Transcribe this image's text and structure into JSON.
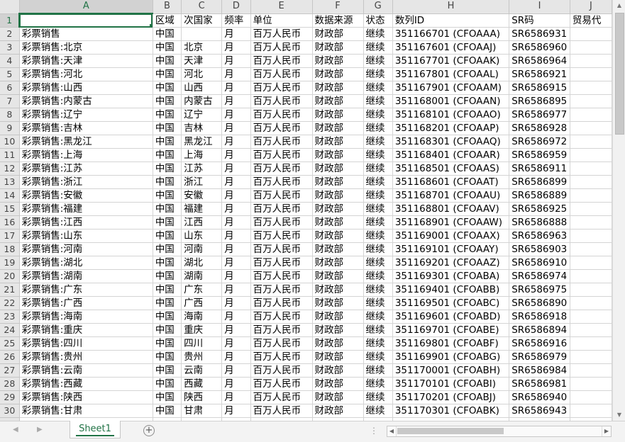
{
  "columns": [
    "A",
    "B",
    "C",
    "D",
    "E",
    "F",
    "G",
    "H",
    "I",
    "J"
  ],
  "header": [
    "",
    "区域",
    "次国家",
    "频率",
    "单位",
    "数据来源",
    "状态",
    "数列ID",
    "SR码",
    "贸易代"
  ],
  "rows": [
    [
      "彩票销售",
      "中国",
      "",
      "月",
      "百万人民币",
      "财政部",
      "继续",
      "351166701 (CFOAAA)",
      "SR6586931",
      ""
    ],
    [
      "彩票销售:北京",
      "中国",
      "北京",
      "月",
      "百万人民币",
      "财政部",
      "继续",
      "351167601 (CFOAAJ)",
      "SR6586960",
      ""
    ],
    [
      "彩票销售:天津",
      "中国",
      "天津",
      "月",
      "百万人民币",
      "财政部",
      "继续",
      "351167701 (CFOAAK)",
      "SR6586964",
      ""
    ],
    [
      "彩票销售:河北",
      "中国",
      "河北",
      "月",
      "百万人民币",
      "财政部",
      "继续",
      "351167801 (CFOAAL)",
      "SR6586921",
      ""
    ],
    [
      "彩票销售:山西",
      "中国",
      "山西",
      "月",
      "百万人民币",
      "财政部",
      "继续",
      "351167901 (CFOAAM)",
      "SR6586915",
      ""
    ],
    [
      "彩票销售:内蒙古",
      "中国",
      "内蒙古",
      "月",
      "百万人民币",
      "财政部",
      "继续",
      "351168001 (CFOAAN)",
      "SR6586895",
      ""
    ],
    [
      "彩票销售:辽宁",
      "中国",
      "辽宁",
      "月",
      "百万人民币",
      "财政部",
      "继续",
      "351168101 (CFOAAO)",
      "SR6586977",
      ""
    ],
    [
      "彩票销售:吉林",
      "中国",
      "吉林",
      "月",
      "百万人民币",
      "财政部",
      "继续",
      "351168201 (CFOAAP)",
      "SR6586928",
      ""
    ],
    [
      "彩票销售:黑龙江",
      "中国",
      "黑龙江",
      "月",
      "百万人民币",
      "财政部",
      "继续",
      "351168301 (CFOAAQ)",
      "SR6586972",
      ""
    ],
    [
      "彩票销售:上海",
      "中国",
      "上海",
      "月",
      "百万人民币",
      "财政部",
      "继续",
      "351168401 (CFOAAR)",
      "SR6586959",
      ""
    ],
    [
      "彩票销售:江苏",
      "中国",
      "江苏",
      "月",
      "百万人民币",
      "财政部",
      "继续",
      "351168501 (CFOAAS)",
      "SR6586911",
      ""
    ],
    [
      "彩票销售:浙江",
      "中国",
      "浙江",
      "月",
      "百万人民币",
      "财政部",
      "继续",
      "351168601 (CFOAAT)",
      "SR6586899",
      ""
    ],
    [
      "彩票销售:安徽",
      "中国",
      "安徽",
      "月",
      "百万人民币",
      "财政部",
      "继续",
      "351168701 (CFOAAU)",
      "SR6586889",
      ""
    ],
    [
      "彩票销售:福建",
      "中国",
      "福建",
      "月",
      "百万人民币",
      "财政部",
      "继续",
      "351168801 (CFOAAV)",
      "SR6586925",
      ""
    ],
    [
      "彩票销售:江西",
      "中国",
      "江西",
      "月",
      "百万人民币",
      "财政部",
      "继续",
      "351168901 (CFOAAW)",
      "SR6586888",
      ""
    ],
    [
      "彩票销售:山东",
      "中国",
      "山东",
      "月",
      "百万人民币",
      "财政部",
      "继续",
      "351169001 (CFOAAX)",
      "SR6586963",
      ""
    ],
    [
      "彩票销售:河南",
      "中国",
      "河南",
      "月",
      "百万人民币",
      "财政部",
      "继续",
      "351169101 (CFOAAY)",
      "SR6586903",
      ""
    ],
    [
      "彩票销售:湖北",
      "中国",
      "湖北",
      "月",
      "百万人民币",
      "财政部",
      "继续",
      "351169201 (CFOAAZ)",
      "SR6586910",
      ""
    ],
    [
      "彩票销售:湖南",
      "中国",
      "湖南",
      "月",
      "百万人民币",
      "财政部",
      "继续",
      "351169301 (CFOABA)",
      "SR6586974",
      ""
    ],
    [
      "彩票销售:广东",
      "中国",
      "广东",
      "月",
      "百万人民币",
      "财政部",
      "继续",
      "351169401 (CFOABB)",
      "SR6586975",
      ""
    ],
    [
      "彩票销售:广西",
      "中国",
      "广西",
      "月",
      "百万人民币",
      "财政部",
      "继续",
      "351169501 (CFOABC)",
      "SR6586890",
      ""
    ],
    [
      "彩票销售:海南",
      "中国",
      "海南",
      "月",
      "百万人民币",
      "财政部",
      "继续",
      "351169601 (CFOABD)",
      "SR6586918",
      ""
    ],
    [
      "彩票销售:重庆",
      "中国",
      "重庆",
      "月",
      "百万人民币",
      "财政部",
      "继续",
      "351169701 (CFOABE)",
      "SR6586894",
      ""
    ],
    [
      "彩票销售:四川",
      "中国",
      "四川",
      "月",
      "百万人民币",
      "财政部",
      "继续",
      "351169801 (CFOABF)",
      "SR6586916",
      ""
    ],
    [
      "彩票销售:贵州",
      "中国",
      "贵州",
      "月",
      "百万人民币",
      "财政部",
      "继续",
      "351169901 (CFOABG)",
      "SR6586979",
      ""
    ],
    [
      "彩票销售:云南",
      "中国",
      "云南",
      "月",
      "百万人民币",
      "财政部",
      "继续",
      "351170001 (CFOABH)",
      "SR6586984",
      ""
    ],
    [
      "彩票销售:西藏",
      "中国",
      "西藏",
      "月",
      "百万人民币",
      "财政部",
      "继续",
      "351170101 (CFOABI)",
      "SR6586981",
      ""
    ],
    [
      "彩票销售:陕西",
      "中国",
      "陕西",
      "月",
      "百万人民币",
      "财政部",
      "继续",
      "351170201 (CFOABJ)",
      "SR6586940",
      ""
    ],
    [
      "彩票销售:甘肃",
      "中国",
      "甘肃",
      "月",
      "百万人民币",
      "财政部",
      "继续",
      "351170301 (CFOABK)",
      "SR6586943",
      ""
    ]
  ],
  "partial_row_label": "31",
  "sheet_tab": "Sheet1",
  "add_sheet_symbol": "+",
  "icons": {
    "scroll_up": "▲",
    "scroll_down": "▼",
    "scroll_left": "◀",
    "scroll_right": "▶",
    "sheet_nav_prev": "◀",
    "sheet_nav_next": "▶",
    "tab_split": "⋮"
  },
  "colors": {
    "accent": "#217346",
    "header_bg": "#e6e6e6",
    "gridline": "#d4d4d4"
  }
}
